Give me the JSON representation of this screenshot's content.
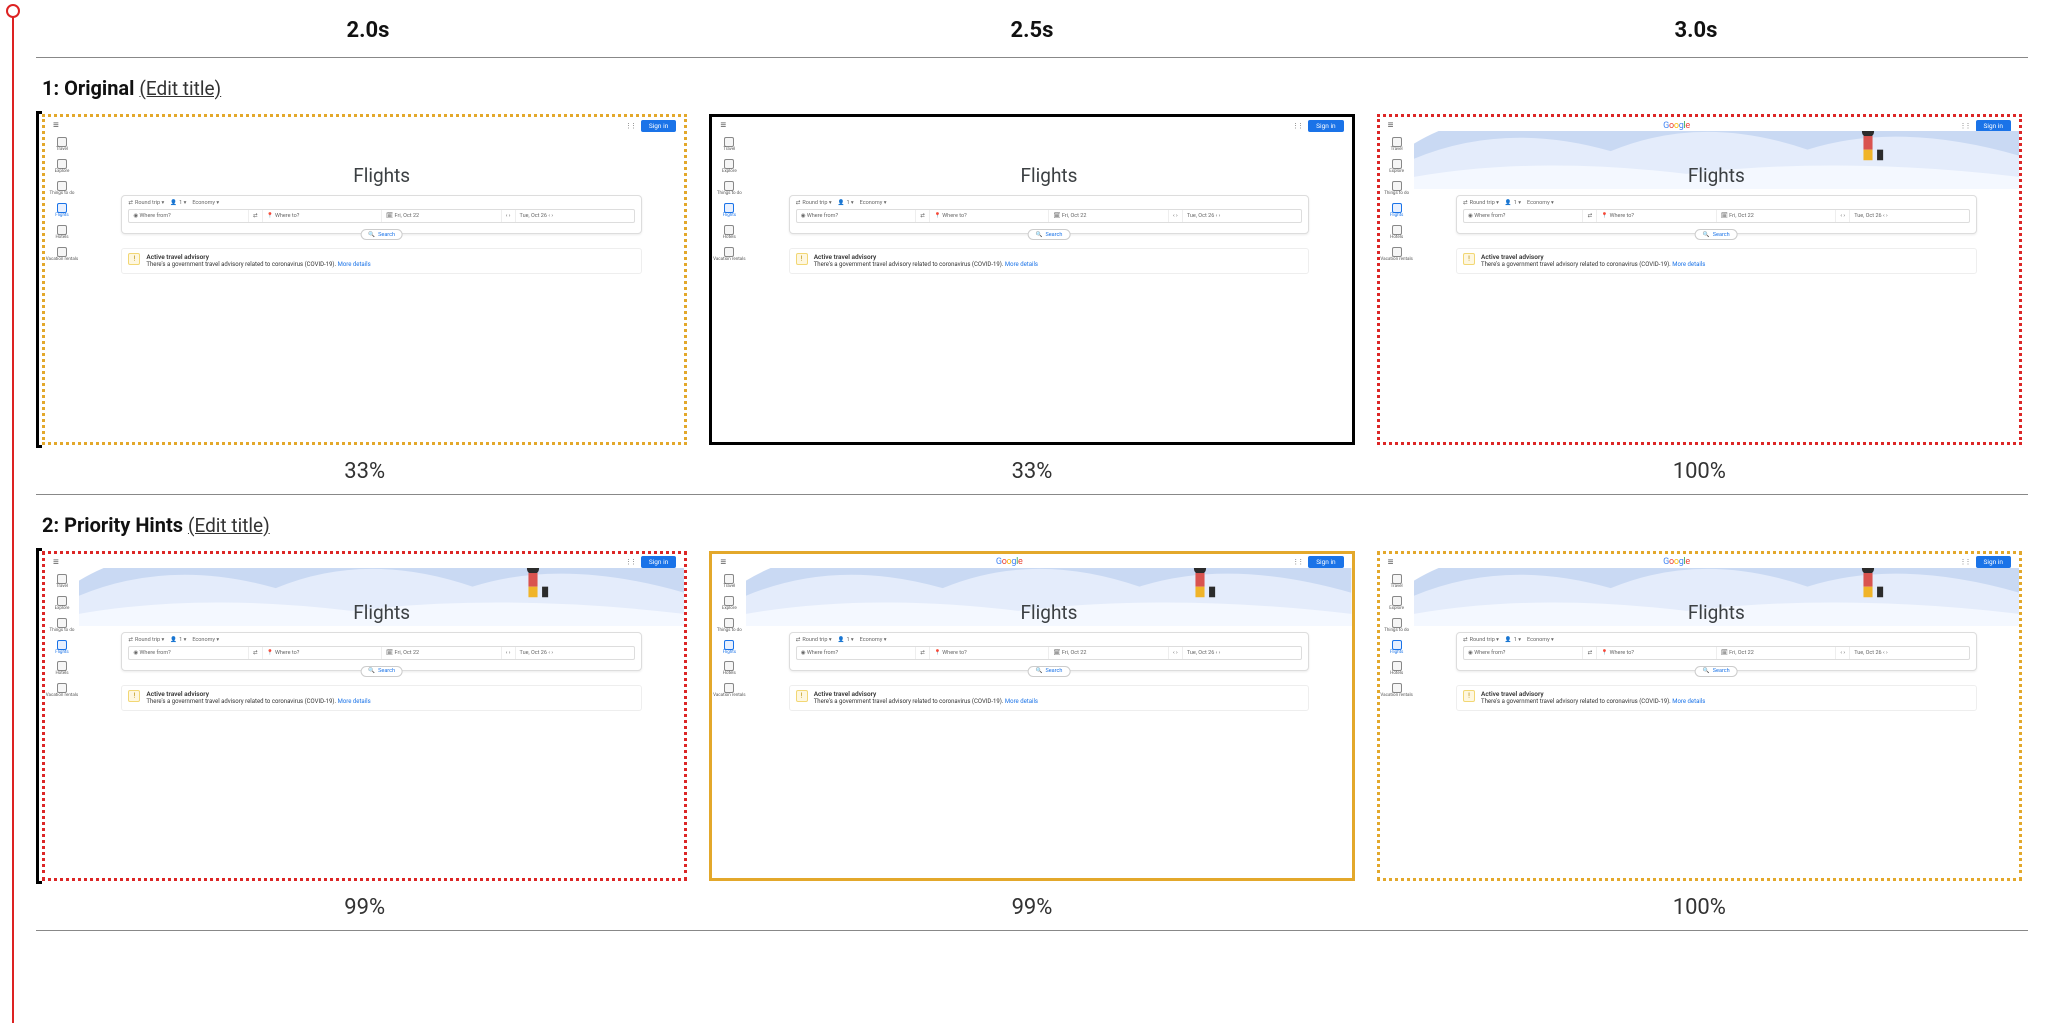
{
  "timeline": {
    "times": [
      "2.0s",
      "2.5s",
      "3.0s"
    ]
  },
  "edit_title_label": "(Edit title)",
  "gf_sidebar_labels": [
    "Travel",
    "Explore",
    "Things to do",
    "Flights",
    "Hotels",
    "Vacation rentals"
  ],
  "gf_sidebar_active_index": 3,
  "gf_ui": {
    "signin": "Sign in",
    "logo": "Google",
    "title": "Flights",
    "trip_type": "Round trip",
    "passengers": "1",
    "class": "Economy",
    "from_placeholder": "Where from?",
    "to_placeholder": "Where to?",
    "date_out": "Fri, Oct 22",
    "date_back": "Tue, Oct 26",
    "search": "Search",
    "advisory_title": "Active travel advisory",
    "advisory_body": "There's a government travel advisory related to coronavirus (COVID-19).",
    "advisory_more": "More details"
  },
  "rows": [
    {
      "index": "1",
      "title": "Original",
      "frames": [
        {
          "pct": "33%",
          "border": "bord-dotted-orange",
          "hero": false,
          "logo": false,
          "leftbar": true
        },
        {
          "pct": "33%",
          "border": "bord-solid-black",
          "hero": false,
          "logo": false,
          "leftbar": false
        },
        {
          "pct": "100%",
          "border": "bord-dotted-red",
          "hero": true,
          "logo": true,
          "leftbar": false
        }
      ]
    },
    {
      "index": "2",
      "title": "Priority Hints",
      "frames": [
        {
          "pct": "99%",
          "border": "bord-dotted-red",
          "hero": true,
          "logo": false,
          "leftbar": true
        },
        {
          "pct": "99%",
          "border": "bord-solid-orange",
          "hero": true,
          "logo": true,
          "leftbar": false
        },
        {
          "pct": "100%",
          "border": "bord-dotted-orange",
          "hero": true,
          "logo": true,
          "leftbar": false
        }
      ]
    }
  ]
}
